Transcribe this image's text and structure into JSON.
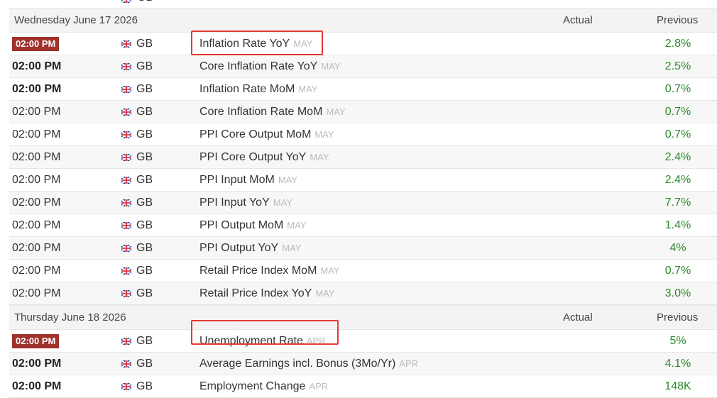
{
  "above_fragment": {
    "country": "GB"
  },
  "sections": [
    {
      "date": "Wednesday June 17 2026",
      "actual_header": "Actual",
      "previous_header": "Previous",
      "rows": [
        {
          "time": "02:00 PM",
          "country": "GB",
          "event": "Inflation Rate YoY",
          "ref": "MAY",
          "previous": "2.8%"
        },
        {
          "time": "02:00 PM",
          "country": "GB",
          "event": "Core Inflation Rate YoY",
          "ref": "MAY",
          "previous": "2.5%"
        },
        {
          "time": "02:00 PM",
          "country": "GB",
          "event": "Inflation Rate MoM",
          "ref": "MAY",
          "previous": "0.7%"
        },
        {
          "time": "02:00 PM",
          "country": "GB",
          "event": "Core Inflation Rate MoM",
          "ref": "MAY",
          "previous": "0.7%"
        },
        {
          "time": "02:00 PM",
          "country": "GB",
          "event": "PPI Core Output MoM",
          "ref": "MAY",
          "previous": "0.7%"
        },
        {
          "time": "02:00 PM",
          "country": "GB",
          "event": "PPI Core Output YoY",
          "ref": "MAY",
          "previous": "2.4%"
        },
        {
          "time": "02:00 PM",
          "country": "GB",
          "event": "PPI Input MoM",
          "ref": "MAY",
          "previous": "2.4%"
        },
        {
          "time": "02:00 PM",
          "country": "GB",
          "event": "PPI Input YoY",
          "ref": "MAY",
          "previous": "7.7%"
        },
        {
          "time": "02:00 PM",
          "country": "GB",
          "event": "PPI Output MoM",
          "ref": "MAY",
          "previous": "1.4%"
        },
        {
          "time": "02:00 PM",
          "country": "GB",
          "event": "PPI Output YoY",
          "ref": "MAY",
          "previous": "4%"
        },
        {
          "time": "02:00 PM",
          "country": "GB",
          "event": "Retail Price Index MoM",
          "ref": "MAY",
          "previous": "0.7%"
        },
        {
          "time": "02:00 PM",
          "country": "GB",
          "event": "Retail Price Index YoY",
          "ref": "MAY",
          "previous": "3.0%"
        }
      ]
    },
    {
      "date": "Thursday June 18 2026",
      "actual_header": "Actual",
      "previous_header": "Previous",
      "rows": [
        {
          "time": "02:00 PM",
          "country": "GB",
          "event": "Unemployment Rate",
          "ref": "APR",
          "previous": "5%"
        },
        {
          "time": "02:00 PM",
          "country": "GB",
          "event": "Average Earnings incl. Bonus (3Mo/Yr)",
          "ref": "APR",
          "previous": "4.1%"
        },
        {
          "time": "02:00 PM",
          "country": "GB",
          "event": "Employment Change",
          "ref": "APR",
          "previous": "148K"
        }
      ]
    }
  ],
  "colors": {
    "badge": "#a0322c",
    "previous_value": "#2a8a2a",
    "reference": "#bbbbbb",
    "highlight_box": "#e53935"
  },
  "icons": {
    "country_flag": "gb-flag-icon"
  }
}
